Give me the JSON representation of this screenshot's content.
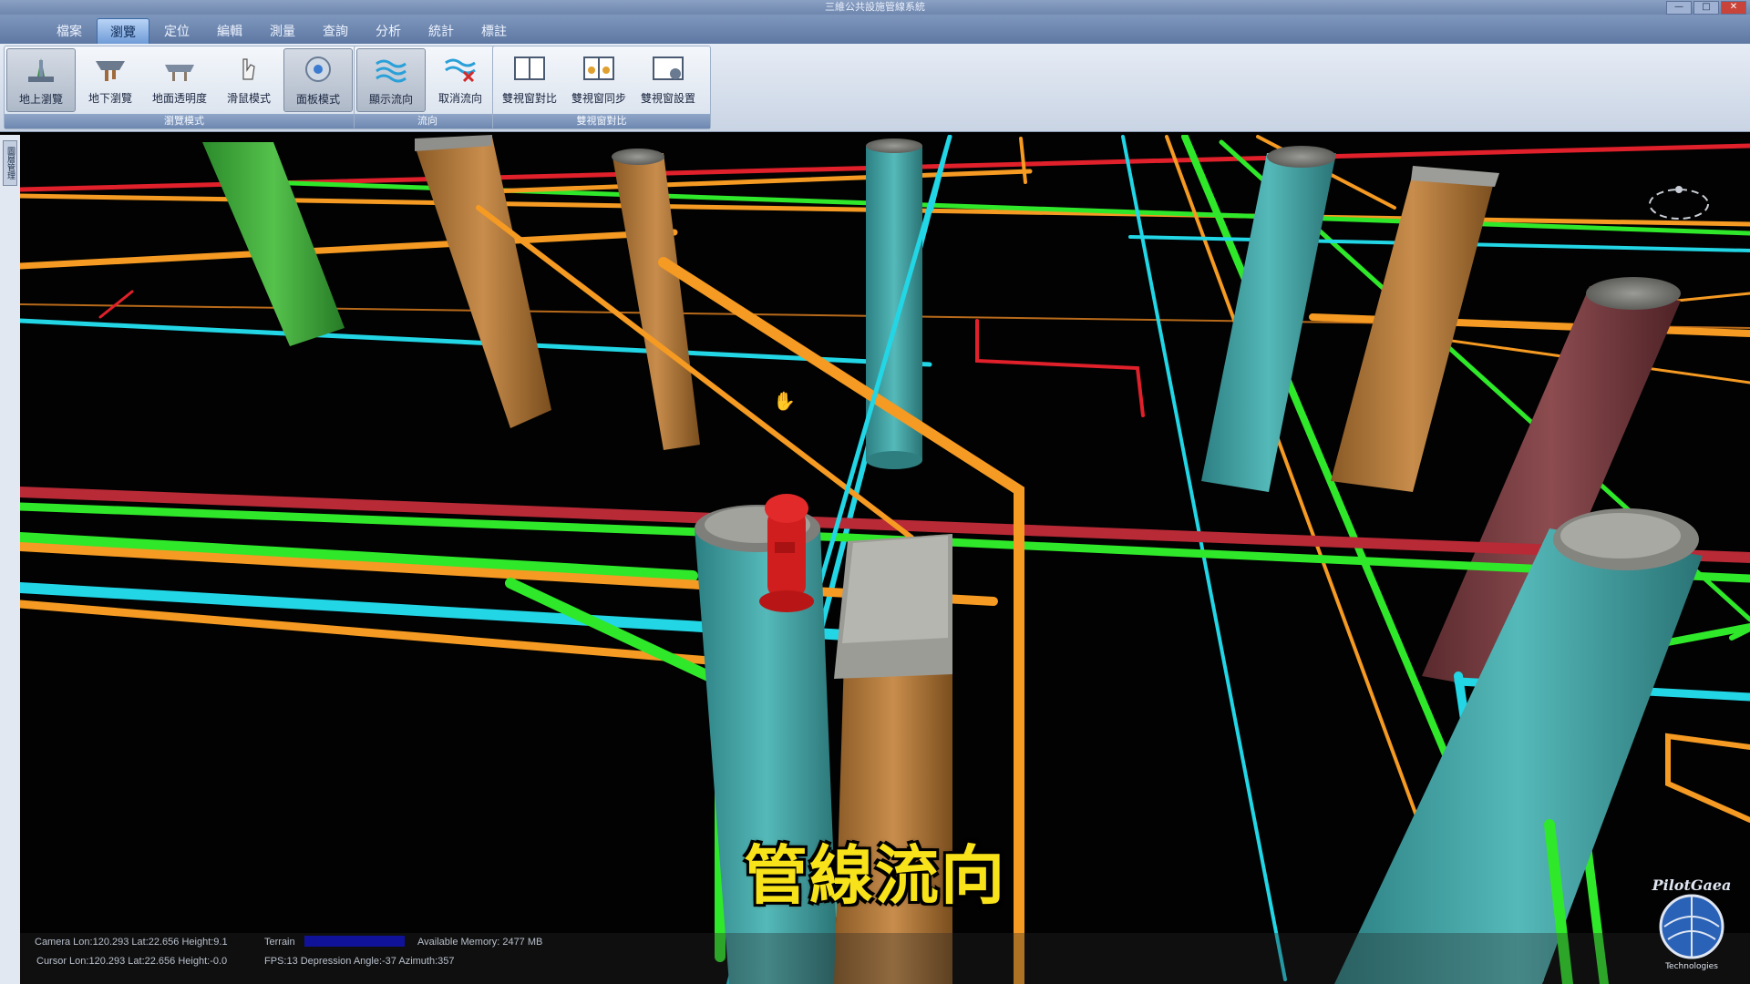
{
  "window": {
    "title": "三維公共設施管線系統",
    "buttons": [
      "—",
      "□",
      "✕"
    ]
  },
  "menu": [
    "檔案",
    "瀏覽",
    "定位",
    "編輯",
    "測量",
    "查詢",
    "分析",
    "統計",
    "標註"
  ],
  "active_menu_index": 1,
  "ribbon": {
    "groups": [
      {
        "title": "瀏覽模式",
        "buttons": [
          {
            "label": "地上瀏覽",
            "icon": "above-ground-icon",
            "active": true
          },
          {
            "label": "地下瀏覽",
            "icon": "underground-icon",
            "active": false
          },
          {
            "label": "地面透明度",
            "icon": "ground-transparency-icon",
            "active": false
          },
          {
            "label": "滑鼠模式",
            "icon": "hand-cursor-icon",
            "active": false
          },
          {
            "label": "面板模式",
            "icon": "panel-mode-icon",
            "active": true
          }
        ]
      },
      {
        "title": "流向",
        "buttons": [
          {
            "label": "顯示流向",
            "icon": "show-flow-icon",
            "active": true
          },
          {
            "label": "取消流向",
            "icon": "cancel-flow-icon",
            "active": false
          }
        ]
      },
      {
        "title": "雙視窗對比",
        "buttons": [
          {
            "label": "雙視窗對比",
            "icon": "dual-window-compare-icon",
            "active": false
          },
          {
            "label": "雙視窗同步",
            "icon": "dual-window-sync-icon",
            "active": false
          },
          {
            "label": "雙視窗設置",
            "icon": "dual-window-settings-icon",
            "active": false
          }
        ]
      }
    ]
  },
  "side_tab_label": "圖層管理",
  "caption": "管線流向",
  "status": {
    "camera": "Camera Lon:120.293 Lat:22.656 Height:9.1",
    "cursor": "Cursor Lon:120.293 Lat:22.656 Height:-0.0",
    "terrain_label": "Terrain",
    "fps": "FPS:13  Depression Angle:-37  Azimuth:357",
    "memory": "Available Memory: 2477 MB"
  },
  "logo": {
    "text": "PilotGaea",
    "sub": "Technologies"
  },
  "colors": {
    "pipe_green": "#2fe82a",
    "pipe_orange": "#f59a22",
    "pipe_cyan": "#22d6e6",
    "pipe_red": "#e0202a",
    "caption": "#f8e21a"
  }
}
